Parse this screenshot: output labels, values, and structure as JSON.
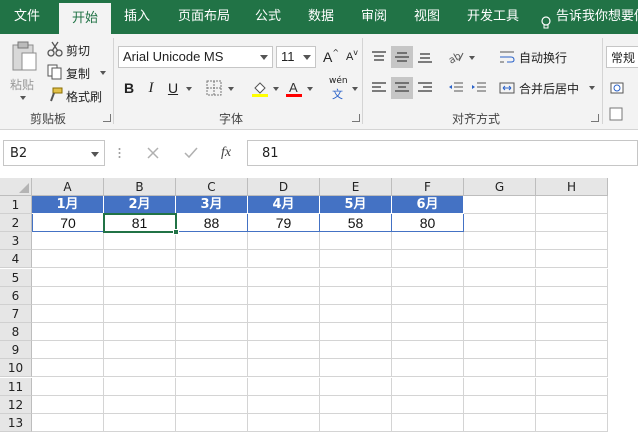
{
  "tabs": [
    {
      "label": "文件",
      "active": false
    },
    {
      "label": "开始",
      "active": true
    },
    {
      "label": "插入",
      "active": false
    },
    {
      "label": "页面布局",
      "active": false
    },
    {
      "label": "公式",
      "active": false
    },
    {
      "label": "数据",
      "active": false
    },
    {
      "label": "审阅",
      "active": false
    },
    {
      "label": "视图",
      "active": false
    },
    {
      "label": "开发工具",
      "active": false
    }
  ],
  "tell_me": "告诉我你想要做",
  "clipboard": {
    "paste": "粘贴",
    "cut": "剪切",
    "copy": "复制",
    "format_painter": "格式刷",
    "group_label": "剪贴板"
  },
  "font": {
    "name": "Arial Unicode MS",
    "size": "11",
    "bold": "B",
    "italic": "I",
    "underline": "U",
    "grow": "A",
    "shrink": "A",
    "phonetic": "wén",
    "group_label": "字体",
    "highlight_color": "#ffff00",
    "font_color": "#ff0000"
  },
  "alignment": {
    "wrap_text": "自动换行",
    "merge_center": "合并后居中",
    "group_label": "对齐方式"
  },
  "number": {
    "format": "常规"
  },
  "formula_bar": {
    "name_box": "B2",
    "fx": "fx",
    "formula": "81"
  },
  "sheet": {
    "columns": [
      "A",
      "B",
      "C",
      "D",
      "E",
      "F",
      "G",
      "H"
    ],
    "rows": [
      "1",
      "2",
      "3",
      "4",
      "5",
      "6",
      "7",
      "8",
      "9",
      "10",
      "11",
      "12",
      "13"
    ],
    "header_row": [
      "1月",
      "2月",
      "3月",
      "4月",
      "5月",
      "6月"
    ],
    "data_row": [
      "70",
      "81",
      "88",
      "79",
      "58",
      "80"
    ],
    "selected_cell": "B2",
    "header_fill": "#4472c4",
    "accent": "#217346"
  }
}
